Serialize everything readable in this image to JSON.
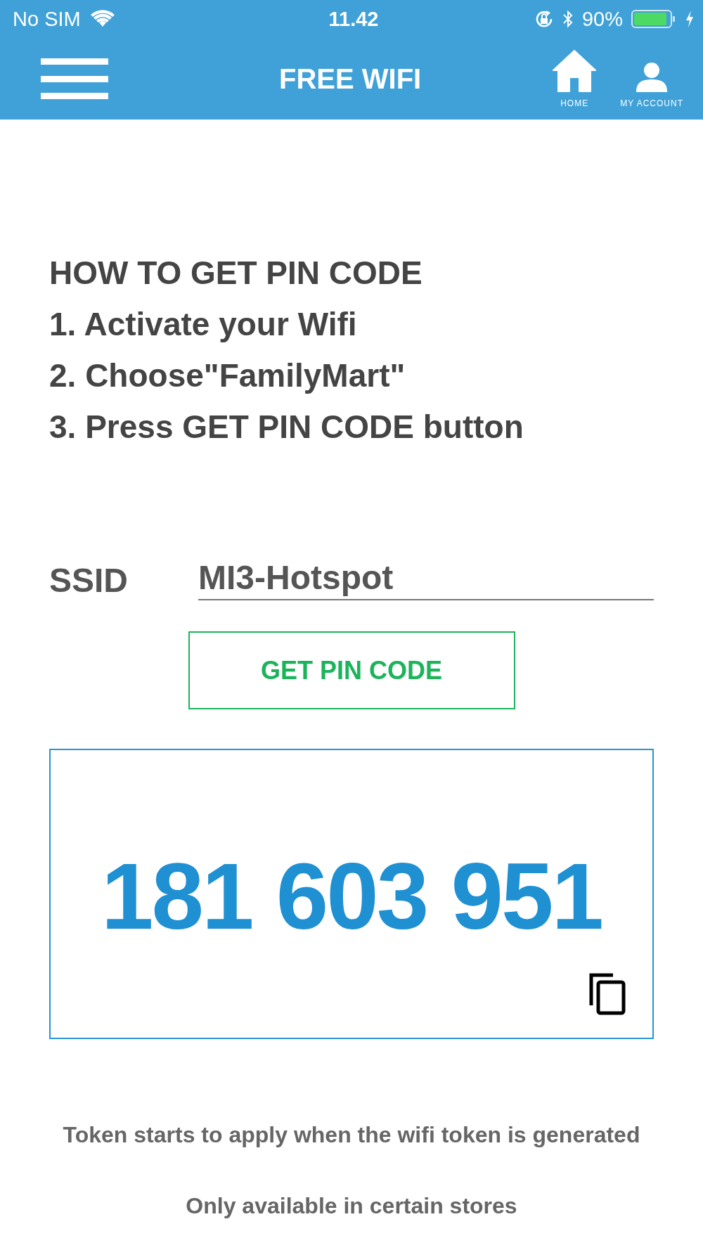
{
  "status_bar": {
    "carrier": "No SIM",
    "time": "11.42",
    "battery_percent": "90%",
    "charging": true
  },
  "header": {
    "title": "FREE WIFI",
    "nav": [
      {
        "kind": "home",
        "label": "HOME"
      },
      {
        "kind": "account",
        "label": "MY ACCOUNT"
      }
    ]
  },
  "instructions": [
    "HOW TO GET PIN CODE",
    "1. Activate your Wifi",
    "2. Choose\"FamilyMart\"",
    "3. Press GET PIN CODE button"
  ],
  "ssid": {
    "label": "SSID",
    "value": "MI3-Hotspot"
  },
  "get_pin_button": "GET PIN CODE",
  "pin_code": "181 603 951",
  "notes": [
    "Token starts to apply when the wifi token is generated",
    "Only available in certain stores"
  ]
}
